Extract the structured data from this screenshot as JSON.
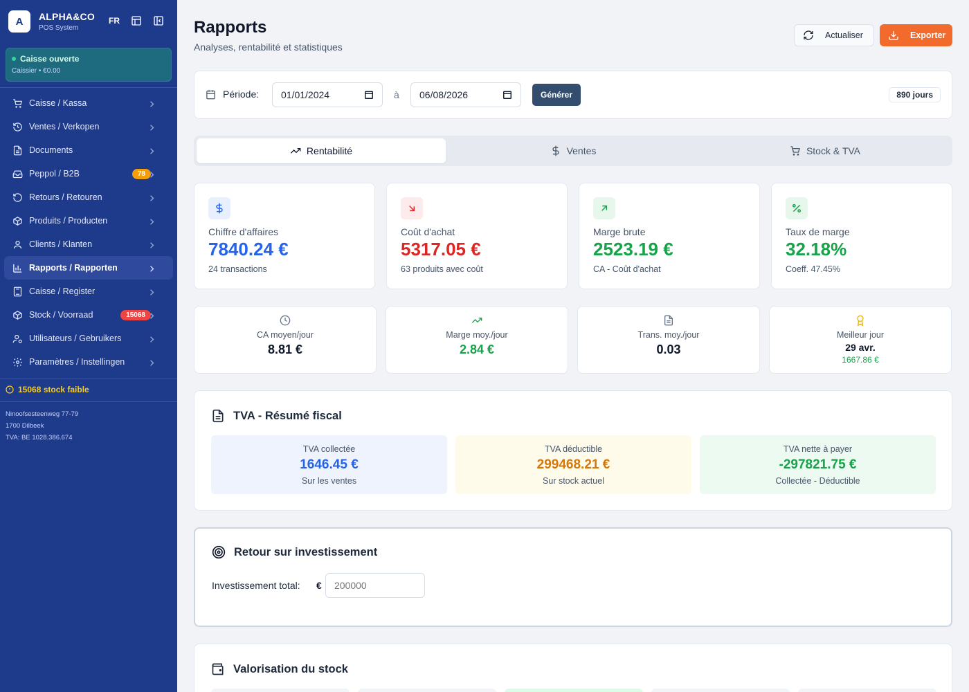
{
  "sidebar": {
    "brand_initial": "A",
    "brand_name": "ALPHA&CO",
    "brand_sub": "POS System",
    "lang": "FR",
    "caisse_title": "Caisse ouverte",
    "caisse_sub": "Caissier • €0.00",
    "items": [
      {
        "label": "Caisse / Kassa",
        "icon": "cart-icon"
      },
      {
        "label": "Ventes / Verkopen",
        "icon": "history-icon"
      },
      {
        "label": "Documents",
        "icon": "document-icon"
      },
      {
        "label": "Peppol / B2B",
        "icon": "inbox-icon",
        "badge": "78"
      },
      {
        "label": "Retours / Retouren",
        "icon": "undo-icon"
      },
      {
        "label": "Produits / Producten",
        "icon": "box-icon"
      },
      {
        "label": "Clients / Klanten",
        "icon": "users-icon"
      },
      {
        "label": "Rapports / Rapporten",
        "icon": "bar-chart-icon",
        "active": true
      },
      {
        "label": "Caisse / Register",
        "icon": "calculator-icon"
      },
      {
        "label": "Stock / Voorraad",
        "icon": "package-icon",
        "badge": "15068"
      },
      {
        "label": "Utilisateurs / Gebruikers",
        "icon": "user-cog-icon"
      },
      {
        "label": "Paramètres / Instellingen",
        "icon": "gear-icon"
      }
    ],
    "low_stock": "15068 stock faible",
    "address_line1": "Ninoofsesteenweg 77-79",
    "address_line2": "1700 Dilbeek",
    "address_line3": "TVA: BE 1028.386.674"
  },
  "header": {
    "title": "Rapports",
    "subtitle": "Analyses, rentabilité et statistiques",
    "refresh_label": "Actualiser",
    "export_label": "Exporter"
  },
  "period": {
    "label": "Période:",
    "from": "01/01/2024",
    "separator": "à",
    "to": "06/08/2026",
    "generate_label": "Générer",
    "days": "890 jours"
  },
  "tabs": [
    {
      "label": "Rentabilité",
      "active": true
    },
    {
      "label": "Ventes"
    },
    {
      "label": "Stock & TVA"
    }
  ],
  "kpis": [
    {
      "label": "Chiffre d'affaires",
      "value": "7840.24 €",
      "sub": "24 transactions",
      "color": "#2563eb"
    },
    {
      "label": "Coût d'achat",
      "value": "5317.05 €",
      "sub": "63 produits avec coût",
      "color": "#dc2626"
    },
    {
      "label": "Marge brute",
      "value": "2523.19 €",
      "sub": "CA - Coût d'achat",
      "color": "#16a34a"
    },
    {
      "label": "Taux de marge",
      "value": "32.18%",
      "sub": "Coeff. 47.45%",
      "color": "#16a34a"
    }
  ],
  "minis": [
    {
      "label": "CA moyen/jour",
      "value": "8.81 €"
    },
    {
      "label": "Marge moy./jour",
      "value": "2.84 €"
    },
    {
      "label": "Trans. moy./jour",
      "value": "0.03"
    },
    {
      "label": "Meilleur jour",
      "value": "29 avr.",
      "sub": "1667.86 €"
    }
  ],
  "tva": {
    "title": "TVA - Résumé fiscal",
    "boxes": [
      {
        "label": "TVA collectée",
        "value": "1646.45 €",
        "sub": "Sur les ventes"
      },
      {
        "label": "TVA déductible",
        "value": "299468.21 €",
        "sub": "Sur stock actuel"
      },
      {
        "label": "TVA nette à payer",
        "value": "-297821.75 €",
        "sub": "Collectée - Déductible"
      }
    ]
  },
  "roi": {
    "title": "Retour sur investissement",
    "label": "Investissement total:",
    "currency": "€",
    "placeholder": "200000"
  },
  "valo": {
    "title": "Valorisation du stock"
  }
}
